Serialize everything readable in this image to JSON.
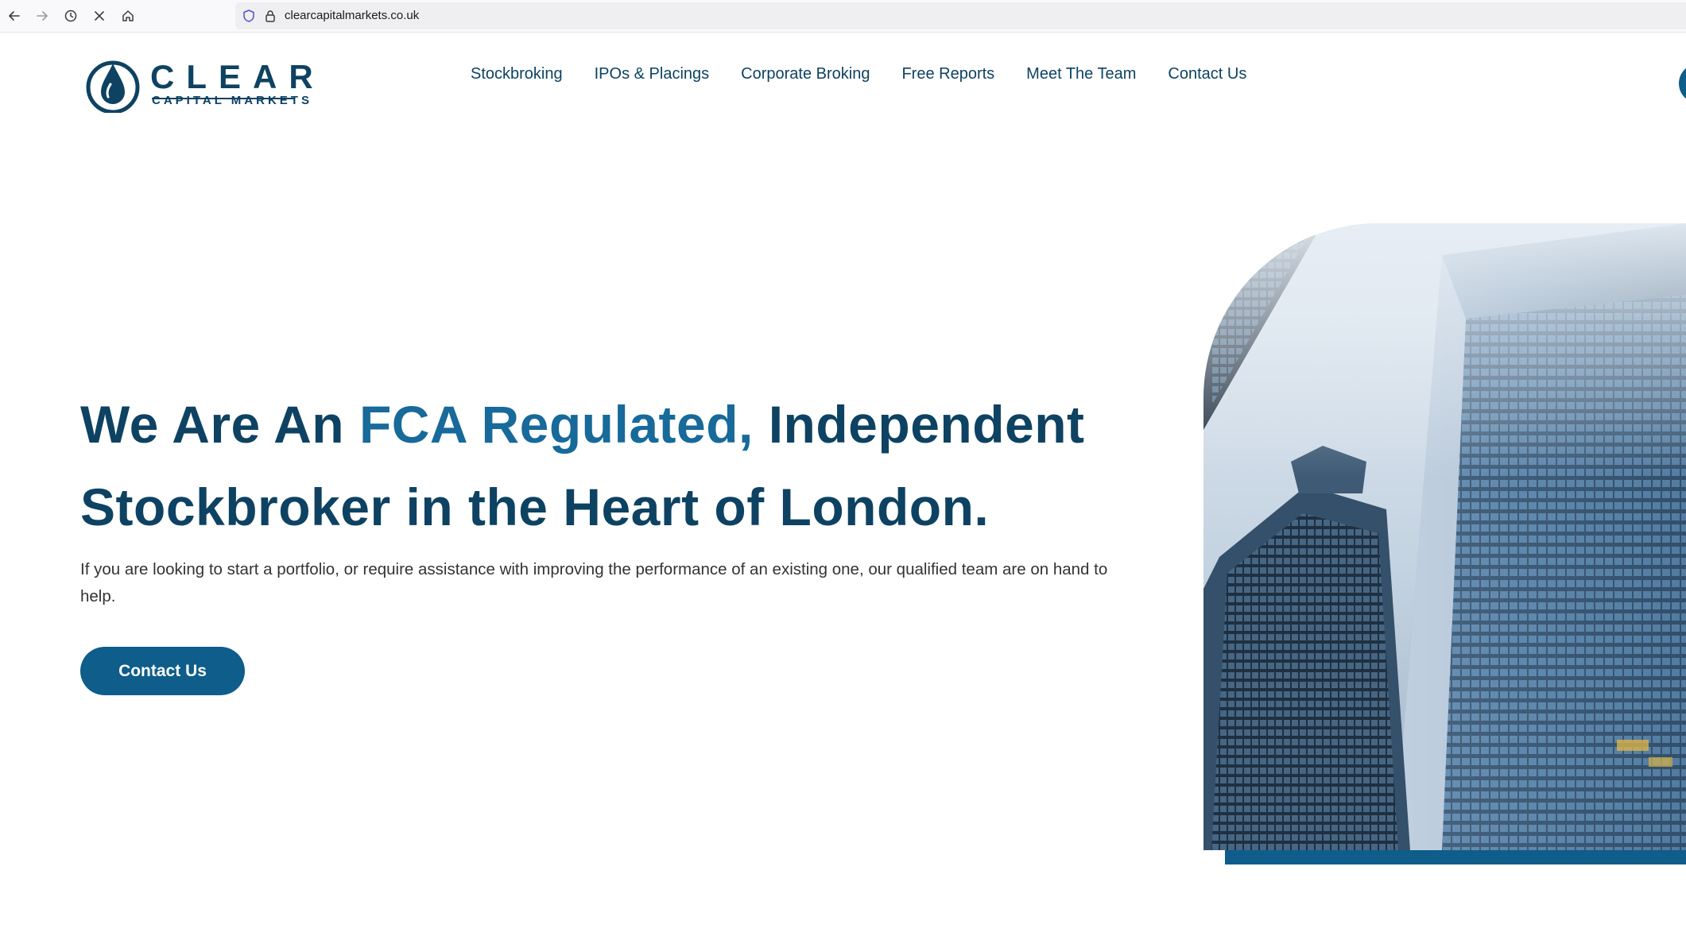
{
  "browser": {
    "url": "clearcapitalmarkets.co.uk",
    "icons": [
      "back-arrow-icon",
      "forward-arrow-icon",
      "history-icon",
      "stop-icon",
      "home-icon",
      "shield-icon",
      "lock-icon"
    ]
  },
  "brand": {
    "name": "CLEAR",
    "tagline": "CAPITAL MARKETS",
    "colors": {
      "primary": "#0e4262",
      "accent": "#176a9a",
      "button": "#0e5d8a"
    }
  },
  "nav": {
    "items": [
      {
        "label": "Stockbroking"
      },
      {
        "label": "IPOs & Placings"
      },
      {
        "label": "Corporate Broking"
      },
      {
        "label": "Free Reports"
      },
      {
        "label": "Meet The Team"
      },
      {
        "label": "Contact Us"
      }
    ]
  },
  "hero": {
    "heading_part1": "We Are An ",
    "heading_accent": "FCA Regulated,",
    "heading_part2": " Independent Stockbroker in the Heart of London.",
    "text": "If you are looking to start a portfolio, or require assistance with improving the performance of an existing one, our qualified team are on hand to help.",
    "cta_label": "Contact Us"
  }
}
